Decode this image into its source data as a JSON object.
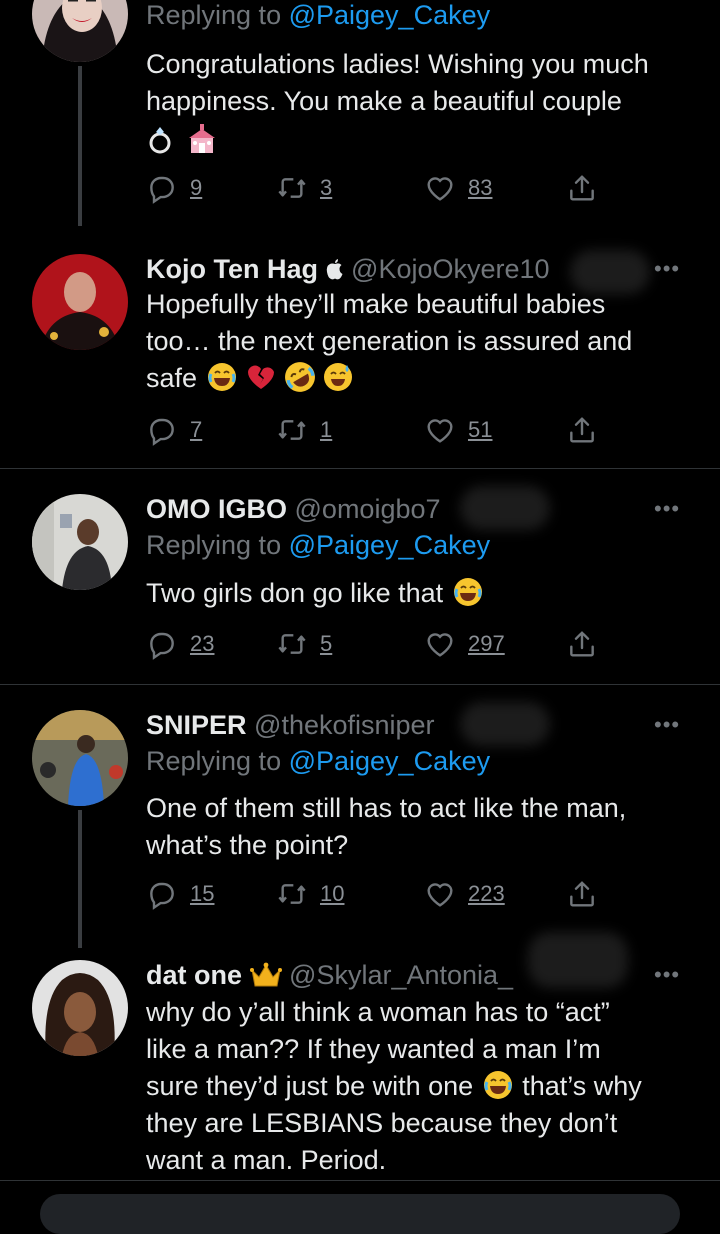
{
  "tweets": [
    {
      "avatar": "avatar-woman-red-lips",
      "replying_prefix": "Replying to ",
      "replying_mention": "@Paigey_Cakey",
      "text": "Congratulations ladies! Wishing you much happiness. You make a beautiful couple",
      "emoji": [
        "ring-icon",
        "wedding-chapel-icon"
      ],
      "replies": "9",
      "retweets": "3",
      "likes": "83"
    },
    {
      "avatar": "avatar-man-red-background",
      "name": "Kojo Ten Hag",
      "badge": "apple-icon",
      "handle": "@KojoOkyere10",
      "text_line1": "Hopefully they’ll make beautiful babies",
      "text_line2": "too… the next generation is assured and",
      "text_line3": "safe",
      "emoji": [
        "tears-of-joy-icon",
        "broken-heart-icon",
        "rofl-icon",
        "sweat-smile-icon"
      ],
      "replies": "7",
      "retweets": "1",
      "likes": "51"
    },
    {
      "avatar": "avatar-suited-man",
      "name": "OMO IGBO",
      "handle": "@omoigbo7",
      "replying_prefix": "Replying to ",
      "replying_mention": "@Paigey_Cakey",
      "text": "Two girls don go like that",
      "emoji": [
        "tears-of-joy-icon"
      ],
      "replies": "23",
      "retweets": "5",
      "likes": "297"
    },
    {
      "avatar": "avatar-crowd",
      "name": "SNIPER",
      "handle": "@thekofisniper",
      "replying_prefix": "Replying to ",
      "replying_mention": "@Paigey_Cakey",
      "text_line1": "One of them still has to act like the man,",
      "text_line2": "what’s the point?",
      "replies": "15",
      "retweets": "10",
      "likes": "223"
    },
    {
      "avatar": "avatar-woman-curly-hair",
      "name": "dat one",
      "badge": "crown-icon",
      "handle": "@Skylar_Antonia_",
      "text_line1": "why do y’all think a woman has to “act”",
      "text_line2": "like a man?? If they wanted a man I’m",
      "text_line3a": "sure they’d just be with one",
      "text_line3b": "that’s why",
      "text_line4": "they are LESBIANS because they don’t",
      "text_line5": "want a man. Period.",
      "emoji": [
        "tears-of-joy-icon"
      ]
    }
  ],
  "colors": {
    "background": "#000000",
    "text": "#e7e9ea",
    "muted": "#71767b",
    "link": "#1d9bf0",
    "divider": "#2f3336"
  },
  "more_glyph": "•••"
}
